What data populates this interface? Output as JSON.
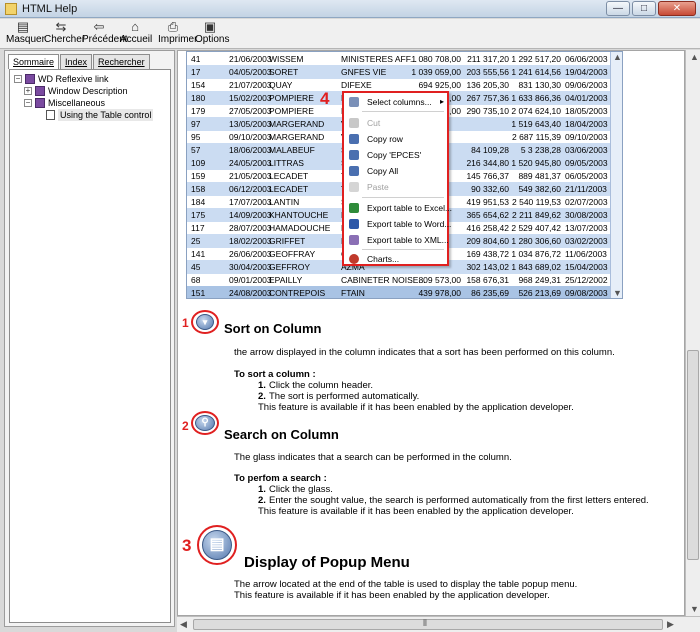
{
  "window": {
    "title": "HTML Help",
    "controls": {
      "minimize": "—",
      "maximize": "□",
      "close": "✕"
    }
  },
  "toolbar": {
    "buttons": [
      {
        "label": "Masquer",
        "icon": "hide-icon"
      },
      {
        "label": "Chercher",
        "icon": "locate-icon"
      },
      {
        "label": "Précédent",
        "icon": "back-icon"
      },
      {
        "label": "Accueil",
        "icon": "home-icon"
      },
      {
        "label": "Imprimer",
        "icon": "print-icon"
      },
      {
        "label": "Options",
        "icon": "options-icon"
      }
    ]
  },
  "nav": {
    "tabs": [
      "Sommaire",
      "Index",
      "Rechercher"
    ],
    "active_tab": "Sommaire",
    "tree": [
      {
        "label": "WD Reflexive link",
        "level": 0,
        "expander": "−",
        "icon": "book-icon"
      },
      {
        "label": "Window Description",
        "level": 1,
        "expander": "+",
        "icon": "book-icon"
      },
      {
        "label": "Miscellaneous",
        "level": 1,
        "expander": "−",
        "icon": "book-icon"
      },
      {
        "label": "Using the Table control",
        "level": 2,
        "expander": "",
        "icon": "page-icon",
        "selected": true
      }
    ]
  },
  "table": {
    "rows": [
      [
        "41",
        "21/06/2003",
        "WISSEM",
        "MINISTERES AFF...",
        "1 080 708,00",
        "211 317,20",
        "1 292 517,20",
        "06/06/2003"
      ],
      [
        "17",
        "04/05/2003",
        "SORET",
        "GNFES VIE",
        "1 039 059,00",
        "203 555,56",
        "1 241 614,56",
        "19/04/2003"
      ],
      [
        "154",
        "21/07/2003",
        "QUAY",
        "DIFEXE",
        "694 925,00",
        "136 205,30",
        "831 130,30",
        "09/06/2003"
      ],
      [
        "180",
        "15/02/2003",
        "POMPIERE",
        "EPITAT",
        "1 366 120,00",
        "267 757,36",
        "1 633 866,36",
        "04/01/2003"
      ],
      [
        "179",
        "27/05/2003",
        "POMPIERE",
        "EPITAT",
        "1 733 180,00",
        "290 735,10",
        "2 074 624,10",
        "18/05/2003"
      ],
      [
        "97",
        "13/05/2003",
        "MARGERAND",
        "VETT",
        "",
        "",
        "1 519 643,40",
        "18/04/2003"
      ],
      [
        "95",
        "09/10/2003",
        "MARGERAND",
        "VETT",
        "",
        "",
        "2 687 115,39",
        "09/10/2003"
      ],
      [
        "57",
        "18/06/2003",
        "MALABEUF",
        "SERI",
        "",
        "84 109,28",
        "5 3 238,28",
        "03/06/2003"
      ],
      [
        "109",
        "24/05/2003",
        "LITTRAS",
        "SAIN",
        "",
        "216 344,80",
        "1 520 945,80",
        "09/05/2003"
      ],
      [
        "159",
        "21/05/2003",
        "LECADET",
        "TEJO",
        "",
        "145 766,37",
        "889 481,37",
        "06/05/2003"
      ],
      [
        "158",
        "06/12/2003",
        "LECADET",
        "TEJO",
        "",
        "90 332,60",
        "549 382,60",
        "21/11/2003"
      ],
      [
        "184",
        "17/07/2003",
        "LANTIN",
        "SOIS",
        "",
        "419 951,53",
        "2 540 119,53",
        "02/07/2003"
      ],
      [
        "175",
        "14/09/2003",
        "KHANTOUCHE",
        "LABC",
        "",
        "365 654,62",
        "2 211 849,62",
        "30/08/2003"
      ],
      [
        "117",
        "28/07/2003",
        "HAMADOUCHE",
        "FTAIN",
        "",
        "416 258,42",
        "2 529 407,42",
        "13/07/2003"
      ],
      [
        "25",
        "18/02/2003",
        "GRIFFET",
        "DDEN",
        "",
        "209 804,60",
        "1 280 306,60",
        "03/02/2003"
      ],
      [
        "141",
        "26/06/2003",
        "GEOFFRAY",
        "GROW",
        "",
        "169 438,72",
        "1 034 876,72",
        "11/06/2003"
      ],
      [
        "45",
        "30/04/2003",
        "GEFFROY",
        "AZMA",
        "",
        "302 143,02",
        "1 843 689,02",
        "15/04/2003"
      ],
      [
        "68",
        "09/01/2003",
        "EPAILLY",
        "CABINETER NOISE...",
        "809 573,00",
        "158 676,31",
        "968 249,31",
        "25/12/2002"
      ],
      [
        "151",
        "24/08/2003",
        "CONTREPOIS",
        "FTAIN",
        "439 978,00",
        "86 235,69",
        "526 213,69",
        "09/08/2003"
      ]
    ],
    "row_styles": [
      "plain",
      "alt",
      "plain",
      "alt",
      "plain",
      "alt",
      "plain",
      "alt",
      "alt",
      "plain",
      "alt",
      "plain",
      "alt",
      "plain",
      "alt",
      "plain",
      "alt",
      "plain",
      "sel"
    ]
  },
  "popup_menu": {
    "callout_number": "4",
    "items": [
      {
        "label": "Select columns...",
        "enabled": true,
        "submenu": true,
        "icon": "columns-icon"
      },
      {
        "label": "Cut",
        "enabled": false,
        "icon": "cut-icon"
      },
      {
        "label": "Copy row",
        "enabled": true,
        "icon": "copy-icon"
      },
      {
        "label": "Copy 'EPCES'",
        "enabled": true,
        "icon": "copy-icon"
      },
      {
        "label": "Copy All",
        "enabled": true,
        "icon": "copy-icon"
      },
      {
        "label": "Paste",
        "enabled": false,
        "icon": "paste-icon"
      },
      {
        "label": "Export table to Excel...",
        "enabled": true,
        "icon": "excel-icon"
      },
      {
        "label": "Export table to Word...",
        "enabled": true,
        "icon": "word-icon"
      },
      {
        "label": "Export table to XML...",
        "enabled": true,
        "icon": "xml-icon"
      },
      {
        "label": "Charts...",
        "enabled": true,
        "icon": "chart-icon"
      }
    ],
    "submenu_arrow": "▸"
  },
  "sections": [
    {
      "number": "1",
      "title": "Sort on Column",
      "description": "the arrow displayed in the column indicates that a sort has been performed on this column.",
      "howto_title": "To sort a column :",
      "steps": [
        {
          "num": "1.",
          "text": "Click the column header."
        },
        {
          "num": "2.",
          "text": "The sort is performed automatically."
        }
      ],
      "note": "This feature is available if it has been enabled by the application developer."
    },
    {
      "number": "2",
      "title": "Search on Column",
      "description": "The glass indicates that a search can be performed in the column.",
      "howto_title": "To perfom a search :",
      "steps": [
        {
          "num": "1.",
          "text": "Click the glass."
        },
        {
          "num": "2.",
          "text": "Enter the sought value, the search is performed automatically from the first letters entered."
        }
      ],
      "note": "This feature is available if it has been enabled by the application developer."
    },
    {
      "number": "3",
      "title": "Display of Popup Menu",
      "description": "The arrow located at the end of the table is used to display the table popup menu.",
      "note": "This feature is available if it has been enabled by the application developer."
    }
  ],
  "scrollbar": {
    "up": "▲",
    "down": "▼",
    "left": "◀",
    "right": "▶",
    "grip": "⦀"
  },
  "colors": {
    "accent_red": "#e02020",
    "row_blue": "#cbdcf2",
    "row_selected": "#a9c3e4"
  }
}
